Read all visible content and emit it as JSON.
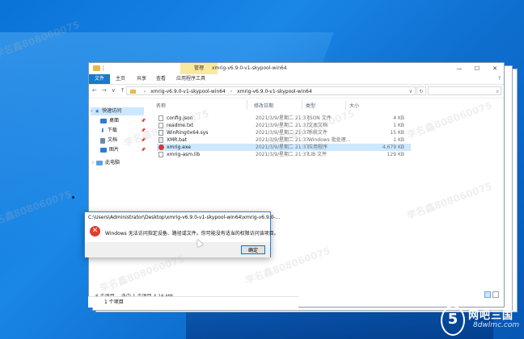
{
  "window": {
    "title": "xmrig-v6.9.0-v1-skypool-win64",
    "manage_tab": "管理",
    "minimize": "—",
    "maximize": "☐",
    "close": "✕"
  },
  "ribbon": {
    "tabs": [
      "文件",
      "主页",
      "共享",
      "查看",
      "应用程序工具"
    ],
    "help": "?"
  },
  "address": {
    "segment1": "xmrig-v6.9.0-v1-skypool-win64",
    "segment2": "xmrig-v6.9.0-v1-skypool-win64",
    "dropdown": "∨",
    "refresh": "↻",
    "search_icon": "🔍"
  },
  "sidebar": {
    "quick_access": "快速访问",
    "items": [
      {
        "label": "桌面",
        "icon": "desktop-icon",
        "color": "#2e7bd0"
      },
      {
        "label": "下载",
        "icon": "download-icon",
        "color": "#2e7bd0"
      },
      {
        "label": "文档",
        "icon": "documents-icon",
        "color": "#6b8aa8"
      },
      {
        "label": "图片",
        "icon": "pictures-icon",
        "color": "#2e7bd0"
      }
    ],
    "this_pc": "此电脑"
  },
  "columns": {
    "name": "名称",
    "date": "修改日期",
    "type": "类型",
    "size": "大小"
  },
  "files": [
    {
      "name": "config.json",
      "date": "2021/3/9/星期二 21:37",
      "type": "JSON 文件",
      "size": "4 KB",
      "icon": "json-file-icon"
    },
    {
      "name": "readme.txt",
      "date": "2021/3/9/星期二 21:37",
      "type": "文本文档",
      "size": "1 KB",
      "icon": "text-file-icon"
    },
    {
      "name": "WinRing0x64.sys",
      "date": "2021/3/9/星期二 21:37",
      "type": "系统文件",
      "size": "15 KB",
      "icon": "system-file-icon"
    },
    {
      "name": "XMR.bat",
      "date": "2021/3/9/星期二 21:37",
      "type": "Windows 批处理...",
      "size": "1 KB",
      "icon": "batch-file-icon"
    },
    {
      "name": "xmrig.exe",
      "date": "2021/3/9/星期二 21:37",
      "type": "应用程序",
      "size": "4,679 KB",
      "icon": "exe-file-icon"
    },
    {
      "name": "xmrig-asm.lib",
      "date": "2021/3/9/星期二 21:37",
      "type": "LIB 文件",
      "size": "129 KB",
      "icon": "lib-file-icon"
    }
  ],
  "status": {
    "count": "6 个项目",
    "selected": "选中 1 个项目  4.16 MB",
    "behind_count": "1 个项目"
  },
  "dialog": {
    "title": "C:\\Users\\Administrator\\Desktop\\xmrig-v6.9.0-v1-skypool-win64\\xmrig-v6.9.0-...",
    "message": "Windows 无法访问指定设备、路径或文件。你可能没有适当的权限访问该项目。",
    "ok": "确定",
    "error_glyph": "✕"
  },
  "watermark": "李名鑫808060075",
  "branding": {
    "mark": "5",
    "name": "网吧三国",
    "url": "8dwlmc.com"
  }
}
